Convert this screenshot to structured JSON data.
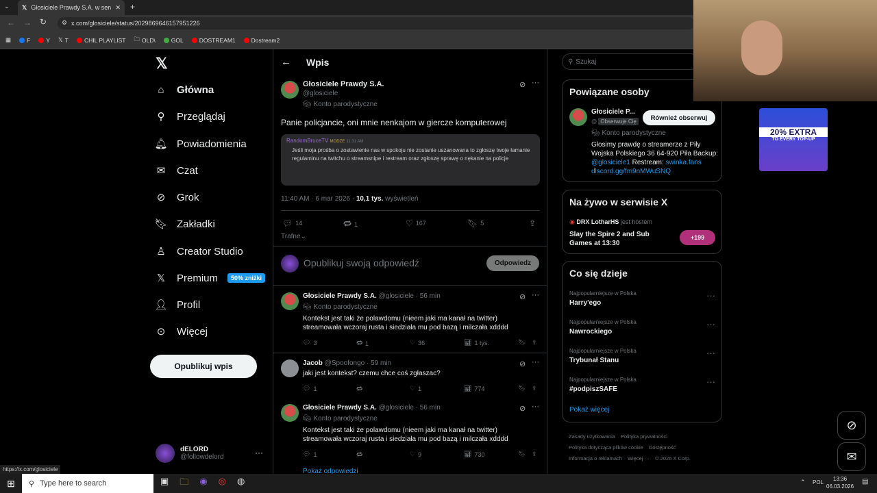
{
  "browser": {
    "tab_title": "Głosiciele Prawdy S.A. w serwis",
    "url": "x.com/glosiciele/status/2029869646157951226",
    "bookmarks": [
      "F",
      "Y",
      "T",
      "CHIL PLAYLIST",
      "OLD\\",
      "GOL",
      "DOSTREAM1",
      "Dostream2"
    ],
    "status_url": "https://x.com/glosiciele"
  },
  "sidebar": {
    "items": [
      {
        "label": "Główna",
        "icon": "home-icon"
      },
      {
        "label": "Przeglądaj",
        "icon": "search-icon"
      },
      {
        "label": "Powiadomienia",
        "icon": "bell-icon"
      },
      {
        "label": "Czat",
        "icon": "mail-icon"
      },
      {
        "label": "Grok",
        "icon": "grok-icon"
      },
      {
        "label": "Zakładki",
        "icon": "bookmark-icon"
      },
      {
        "label": "Creator Studio",
        "icon": "creator-icon"
      },
      {
        "label": "Premium",
        "icon": "x-icon"
      },
      {
        "label": "Profil",
        "icon": "person-icon"
      },
      {
        "label": "Więcej",
        "icon": "more-circle-icon"
      }
    ],
    "premium_badge": "50% zniżki",
    "post_button": "Opublikuj wpis",
    "user": {
      "name": "dELORD",
      "handle": "@followdelord"
    }
  },
  "main": {
    "header": "Wpis",
    "post": {
      "author": "Głosiciele Prawdy S.A.",
      "handle": "@glosiciele",
      "label": "Konto parodystyczne",
      "text": "Panie policjancie, oni mnie nenkajom w giercze komputerowej",
      "embed_user": "RandomBruceTV",
      "embed_badge": "MODZE",
      "embed_time": "11:31 AM",
      "embed_text": "Jeśli moja prośba o zostawienie nas w spokoju nie zostanie uszanowana to zgłoszę twoje łamanie regulaminu na twitchu o streamsnipe i restream oraz  zgłoszę sprawę o nękanie na policje",
      "time": "11:40 AM · 6 mar 2026 ·",
      "views_count": "10,1 tys.",
      "views_label": "wyświetleń",
      "replies": "14",
      "reposts": "1",
      "likes": "167",
      "bookmarks": "5"
    },
    "sort": "Trafne",
    "reply_placeholder": "Opublikuj swoją odpowiedź",
    "reply_button": "Odpowiedz",
    "replies": [
      {
        "author": "Głosiciele Prawdy S.A.",
        "handle": "@glosiciele · 56 min",
        "label": "Konto parodystyczne",
        "text": "Kontekst jest taki że polawdomu (nieem jaki ma kanał na twitter) streamowała wczoraj rusta i siedziała mu pod bazą i milczała xdddd",
        "r": "3",
        "rt": "1",
        "l": "36",
        "v": "1 tys."
      },
      {
        "author": "Jacob",
        "handle": "@Spoofongo · 59 min",
        "label": "",
        "text": "jaki jest kontekst? czemu chce coś zgłaszac?",
        "r": "1",
        "rt": "",
        "l": "1",
        "v": "774"
      },
      {
        "author": "Głosiciele Prawdy S.A.",
        "handle": "@glosiciele · 56 min",
        "label": "Konto parodystyczne",
        "text": "Kontekst jest taki że polawdomu (nieem jaki ma kanał na twitter) streamowała wczoraj rusta i siedziała mu pod bazą i milczała xdddd",
        "r": "1",
        "rt": "",
        "l": "9",
        "v": "730"
      }
    ],
    "show_replies": "Pokaż odpowiedzi"
  },
  "right": {
    "search_placeholder": "Szukaj",
    "related_title": "Powiązane osoby",
    "related": {
      "name": "Głosiciele P...",
      "handle": "@",
      "follows_you": "Obserwuje Cię",
      "button": "Również obserwuj",
      "label": "Konto parodystyczne",
      "bio": "Głosimy prawdę o streamerze z Piły Wojska Polskiego 36 64-920 Piła Backup:",
      "bio_link1": "@glosiciele1",
      "bio_mid": "Restream:",
      "bio_link2": "swinka.fans dlscord.gg/fm9nMWuSNQ"
    },
    "live_title": "Na żywo w serwisie X",
    "live": {
      "host": "DRX LotharHS",
      "host_label": "jest hostem",
      "title": "Slay the Spire 2 and Sub Games at 13:30",
      "count": "+199"
    },
    "trends_title": "Co się dzieje",
    "trends": [
      {
        "context": "Najpopularniejsze w Polska",
        "name": "Harry'ego"
      },
      {
        "context": "Najpopularniejsze w Polska",
        "name": "Nawrockiego"
      },
      {
        "context": "Najpopularniejsze w Polska",
        "name": "Trybunał Stanu"
      },
      {
        "context": "Najpopularniejsze w Polska",
        "name": "#podpiszSAFE"
      }
    ],
    "show_more": "Pokaż więcej",
    "footer": [
      "Zasady użytkowania",
      "Polityka prywatności",
      "Polityka dotycząca plików cookie",
      "Dostępność",
      "Informacja o reklamach",
      "Więcej ···",
      "© 2026 X Corp."
    ]
  },
  "ad": {
    "line1": "20% EXTRA",
    "line2": "TO EVERY TOP-UP"
  },
  "taskbar": {
    "search_placeholder": "Type here to search",
    "lang": "POL",
    "time": "13:36",
    "date": "06.03.2026"
  },
  "colors": {
    "accent": "#1d9bf0",
    "bg": "#000000",
    "button": "#eff3f4"
  }
}
